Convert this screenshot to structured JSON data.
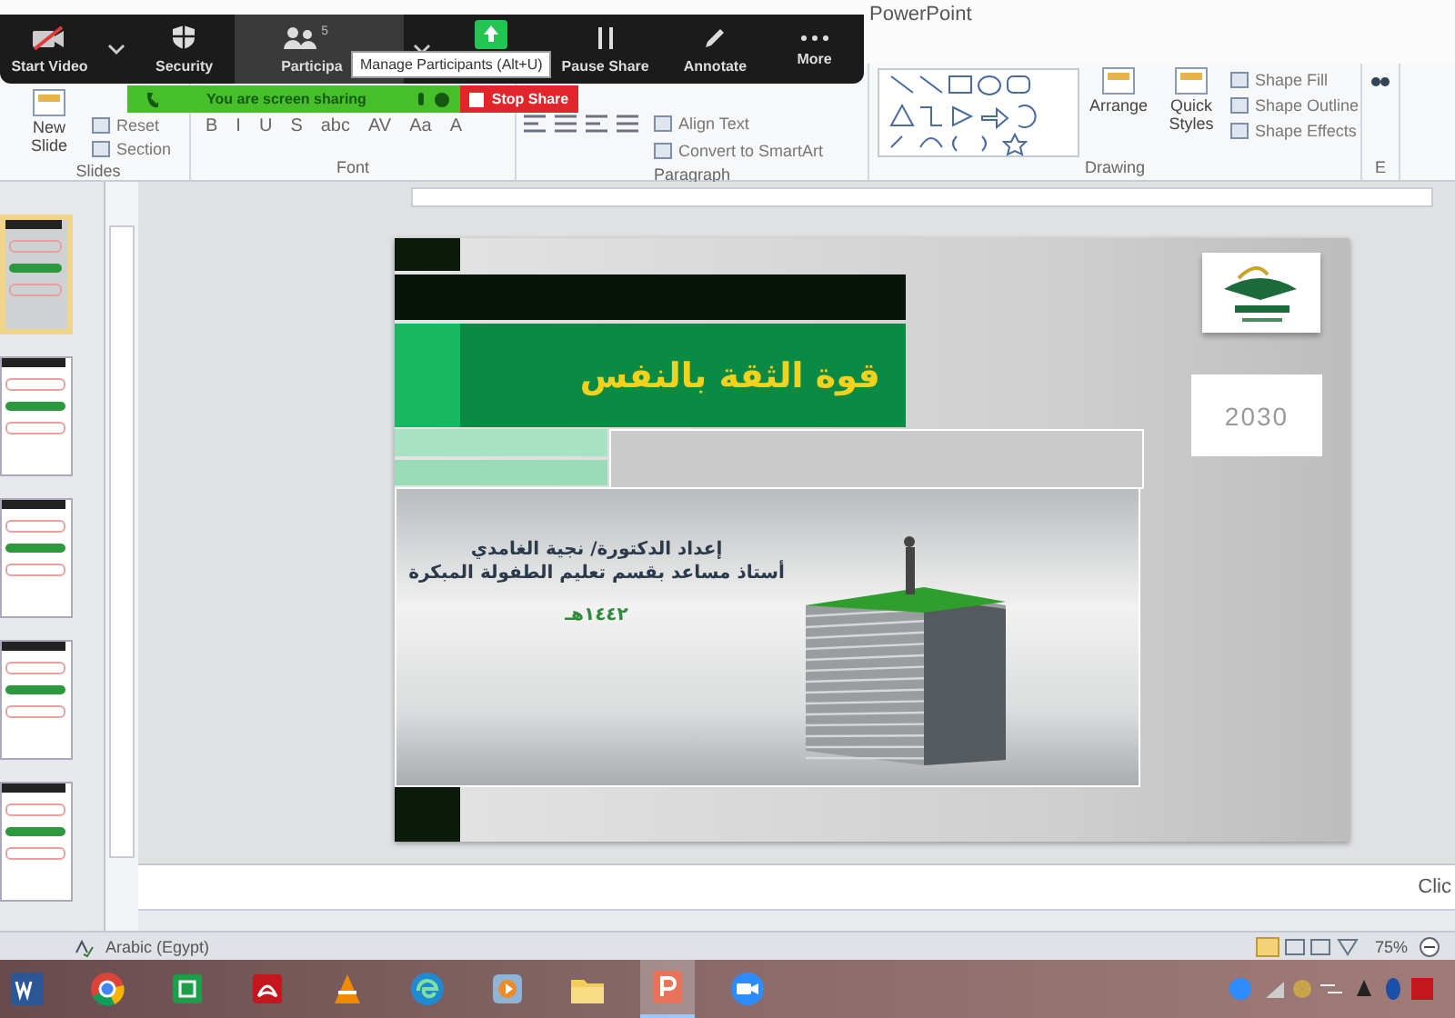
{
  "window": {
    "title": "PowerPoint"
  },
  "zoom_toolbar": {
    "buttons": [
      {
        "kind": "video",
        "label": "Start Video",
        "selected": false
      },
      {
        "kind": "chevron",
        "selected": false
      },
      {
        "kind": "security",
        "label": "Security",
        "selected": false
      },
      {
        "kind": "participants",
        "label": "Participa",
        "badge": "5",
        "selected": true
      },
      {
        "kind": "chevron",
        "selected": false
      },
      {
        "kind": "share",
        "selected": false
      },
      {
        "kind": "pause",
        "label": "Pause Share",
        "selected": false
      },
      {
        "kind": "annotate",
        "label": "Annotate",
        "selected": false
      },
      {
        "kind": "more",
        "label": "More",
        "selected": false
      }
    ],
    "tooltip": "Manage Participants (Alt+U)",
    "sharing_bar": {
      "status": "You are screen sharing",
      "stop_button": "Stop Share"
    }
  },
  "ribbon": {
    "groups": [
      {
        "label": "Slides",
        "items": [
          {
            "kind": "large",
            "label": "New Slide"
          },
          {
            "kind": "small",
            "label": "Reset"
          },
          {
            "kind": "small",
            "label": "Section"
          }
        ]
      },
      {
        "label": "Font",
        "items": [
          {
            "kind": "format",
            "label": "B"
          },
          {
            "kind": "format",
            "label": "I"
          },
          {
            "kind": "format",
            "label": "U"
          },
          {
            "kind": "format",
            "label": "S"
          },
          {
            "kind": "format",
            "label": "abc"
          },
          {
            "kind": "format",
            "label": "AV"
          },
          {
            "kind": "format",
            "label": "Aa"
          },
          {
            "kind": "format",
            "label": "A"
          }
        ]
      },
      {
        "label": "Paragraph",
        "items": [
          {
            "kind": "align"
          },
          {
            "kind": "small",
            "label": "Align Text"
          },
          {
            "kind": "small",
            "label": "Convert to SmartArt"
          }
        ]
      },
      {
        "label": "Drawing",
        "items": [
          {
            "kind": "shapes"
          },
          {
            "kind": "large",
            "label": "Arrange"
          },
          {
            "kind": "large",
            "label": "Quick Styles"
          },
          {
            "kind": "small",
            "label": "Shape Fill"
          },
          {
            "kind": "small",
            "label": "Shape Outline"
          },
          {
            "kind": "small",
            "label": "Shape Effects"
          }
        ]
      },
      {
        "label": "E",
        "items": [
          {
            "kind": "find"
          }
        ]
      }
    ]
  },
  "thumbnails": [
    {
      "selected": true
    },
    {
      "selected": false
    },
    {
      "selected": false
    },
    {
      "selected": false
    },
    {
      "selected": false
    }
  ],
  "slide": {
    "title": "قوة الثقة بالنفس",
    "author": "إعداد الدكتورة/ نجية الغامدي",
    "position": "أستاذ مساعد بقسم تعليم الطفولة المبكرة",
    "date": "١٤٤٢هـ",
    "vision": "2030"
  },
  "notes": {
    "placeholder": "Clic"
  },
  "status_bar": {
    "language": "Arabic (Egypt)",
    "zoom": "75%"
  },
  "taskbar": {
    "apps": [
      {
        "kind": "word",
        "selected": false
      },
      {
        "kind": "chrome",
        "selected": false
      },
      {
        "kind": "sheet",
        "selected": false
      },
      {
        "kind": "acrobat",
        "selected": false
      },
      {
        "kind": "vlc",
        "selected": false
      },
      {
        "kind": "edge",
        "selected": false
      },
      {
        "kind": "media",
        "selected": false
      },
      {
        "kind": "files",
        "selected": false
      },
      {
        "kind": "powerpoint",
        "selected": true
      },
      {
        "kind": "zoom",
        "selected": false
      }
    ]
  }
}
